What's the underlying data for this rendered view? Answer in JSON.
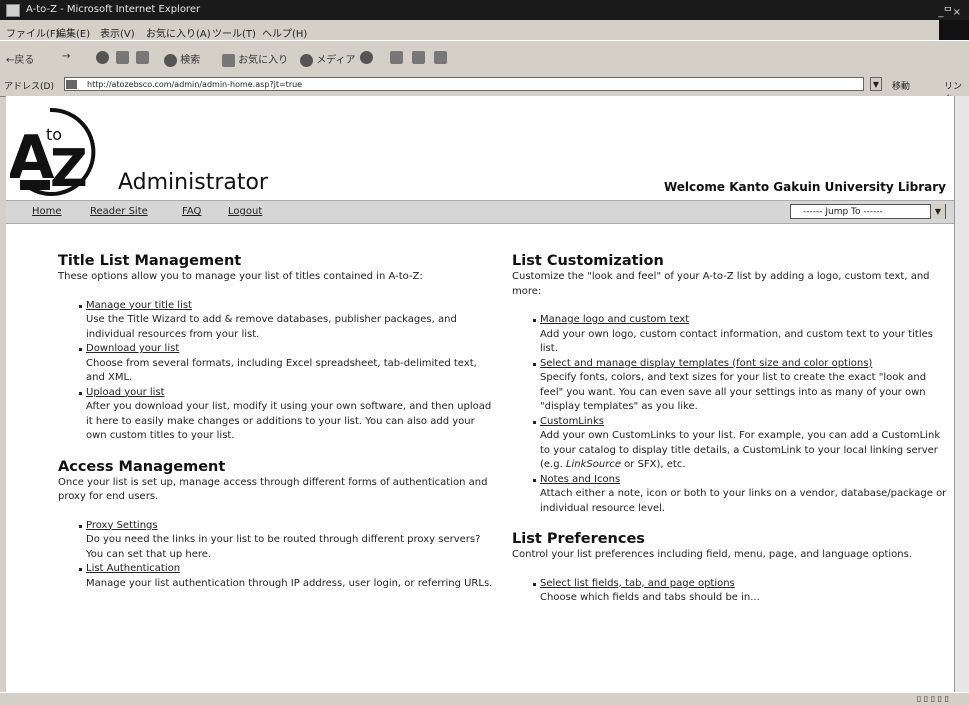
{
  "window": {
    "title": "A-to-Z - Microsoft Internet Explorer",
    "controls": "_ᄆ×"
  },
  "menubar": [
    "ファイル(F)",
    "編集(E)",
    "表示(V)",
    "お気に入り(A)",
    "ツール(T)",
    "ヘルプ(H)"
  ],
  "toolbar": {
    "back": "←戻る",
    "search": "検索",
    "favorites": "お気に入り",
    "media": "メディア"
  },
  "address": {
    "label": "アドレス(D)",
    "url": "http://atozebsco.com/admin/admin-home.asp?jt=true",
    "go": "移動",
    "links": "リンク"
  },
  "header": {
    "admin_title": "Administrator",
    "welcome": "Welcome Kanto Gakuin University Library"
  },
  "nav": {
    "links": [
      "Home",
      "Reader Site",
      "FAQ",
      "Logout"
    ],
    "jump": "------ Jump To ------"
  },
  "left": {
    "title_list": {
      "heading": "Title List Management",
      "intro": "These options allow you to manage your list of titles contained in A-to-Z:",
      "items": [
        {
          "link": "Manage your title list",
          "desc": "Use the Title Wizard to add & remove databases, publisher packages, and individual resources from your list."
        },
        {
          "link": "Download your list",
          "desc": "Choose from several formats, including Excel spreadsheet, tab-delimited text, and XML."
        },
        {
          "link": "Upload your list",
          "desc": "After you download your list, modify it using your own software, and then upload it here to easily make changes or additions to your list. You can also add your own custom titles to your list."
        }
      ]
    },
    "access": {
      "heading": "Access Management",
      "intro": "Once your list is set up, manage access through different forms of authentication and proxy for end users.",
      "items": [
        {
          "link": "Proxy Settings",
          "desc": "Do you need the links in your list to be routed through different proxy servers? You can set that up here."
        },
        {
          "link": "List Authentication",
          "desc": "Manage your list authentication through IP address, user login, or referring URLs."
        }
      ]
    }
  },
  "right": {
    "custom": {
      "heading": "List Customization",
      "intro": "Customize the \"look and feel\" of your A-to-Z list by adding a logo, custom text, and more:",
      "items": [
        {
          "link": "Manage logo and custom text",
          "desc": "Add your own logo, custom contact information, and custom text to your titles list."
        },
        {
          "link": "Select and manage display templates (font size and color options)",
          "desc": "Specify fonts, colors, and text sizes for your list to create the exact \"look and feel\" you want. You can even save all your settings into as many of your own \"display templates\" as you like."
        },
        {
          "link": "CustomLinks",
          "desc_pre": "Add your own CustomLinks to your list. For example, you can add a CustomLink to your catalog to display title details, a CustomLink to your local linking server (e.g. ",
          "desc_em": "LinkSource",
          "desc_post": " or SFX), etc."
        },
        {
          "link": "Notes and Icons",
          "desc": "Attach either a note, icon or both to your links on a vendor, database/package or individual resource level."
        }
      ]
    },
    "prefs": {
      "heading": "List Preferences",
      "intro": "Control your list preferences including field, menu, page, and language options.",
      "items": [
        {
          "link": "Select list fields, tab, and page options",
          "desc": "Choose which fields and tabs should be in..."
        }
      ]
    }
  }
}
